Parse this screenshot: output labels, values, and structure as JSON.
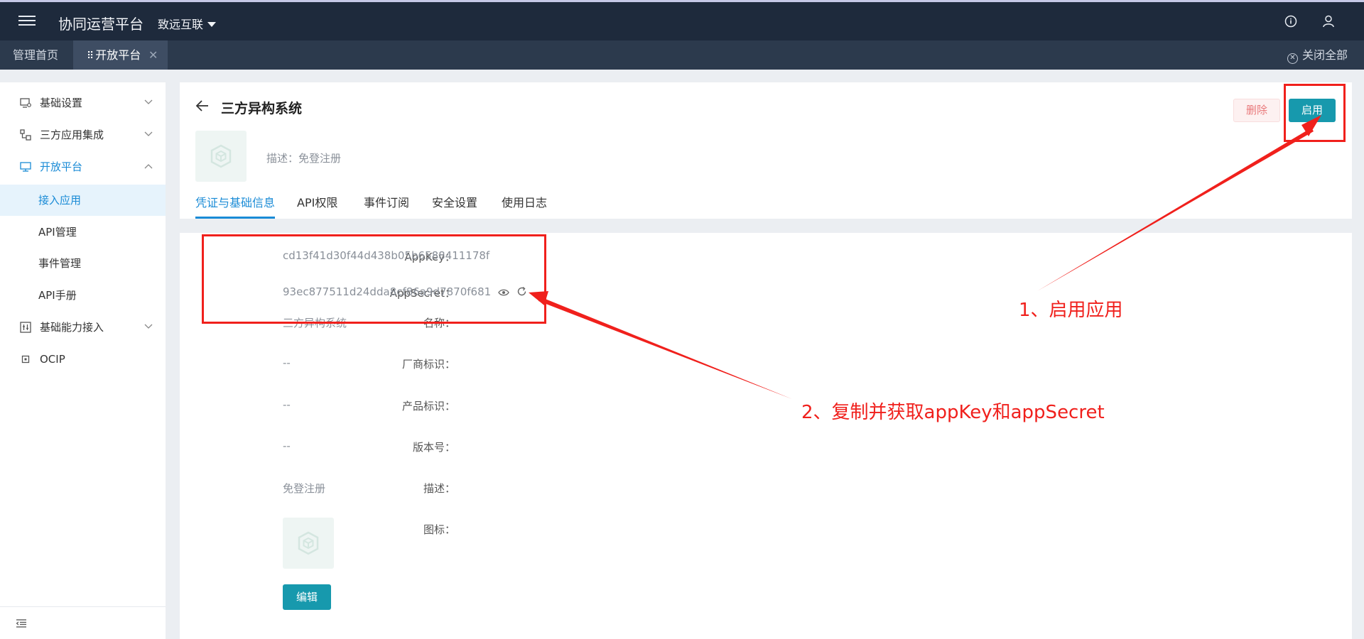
{
  "header": {
    "app_title": "协同运营平台",
    "org_name": "致远互联",
    "icons": [
      "menu-icon",
      "info-icon",
      "user-icon"
    ]
  },
  "tabbar": {
    "tabs": [
      {
        "label": "管理首页"
      },
      {
        "label": "开放平台",
        "active": true
      }
    ],
    "close_all_label": "关闭全部"
  },
  "sidebar": {
    "groups": [
      {
        "label": "基础设置",
        "icon": "settings-monitor-icon",
        "expanded": false
      },
      {
        "label": "三方应用集成",
        "icon": "integration-icon",
        "expanded": false
      },
      {
        "label": "开放平台",
        "icon": "monitor-icon",
        "expanded": true,
        "children": [
          {
            "label": "接入应用",
            "selected": true
          },
          {
            "label": "API管理"
          },
          {
            "label": "事件管理"
          },
          {
            "label": "API手册"
          }
        ]
      },
      {
        "label": "基础能力接入",
        "icon": "sliders-icon",
        "expanded": false
      },
      {
        "label": "OCIP",
        "icon": "square-dot-icon"
      }
    ]
  },
  "page": {
    "title": "三方异构系统",
    "description": "描述：免登注册",
    "buttons": {
      "delete": "删除",
      "enable": "启用"
    },
    "tabs": [
      {
        "label": "凭证与基础信息",
        "active": true
      },
      {
        "label": "API权限"
      },
      {
        "label": "事件订阅"
      },
      {
        "label": "安全设置"
      },
      {
        "label": "使用日志"
      }
    ]
  },
  "details": {
    "fields": [
      {
        "label": "AppKey：",
        "value": "cd13f41d30f44d438b05b6588411178f"
      },
      {
        "label": "AppSecret：",
        "value": "93ec877511d24dda8cf86a9d7870f681"
      },
      {
        "label": "名称：",
        "value": "三方异构系统"
      },
      {
        "label": "厂商标识：",
        "value": "--"
      },
      {
        "label": "产品标识：",
        "value": "--"
      },
      {
        "label": "版本号：",
        "value": "--"
      },
      {
        "label": "描述：",
        "value": "免登注册"
      },
      {
        "label": "图标：",
        "value": ""
      }
    ],
    "edit_button": "编辑"
  },
  "annotations": {
    "step1": "1、启用应用",
    "step2": "2、复制并获取appKey和appSecret",
    "color": "#f0201c"
  },
  "colors": {
    "header_bg": "#1e2a3c",
    "tabbar_bg": "#2c3a4d",
    "accent_blue": "#1a8bd6",
    "primary_button": "#1799ad",
    "danger_text": "#e9797b"
  }
}
